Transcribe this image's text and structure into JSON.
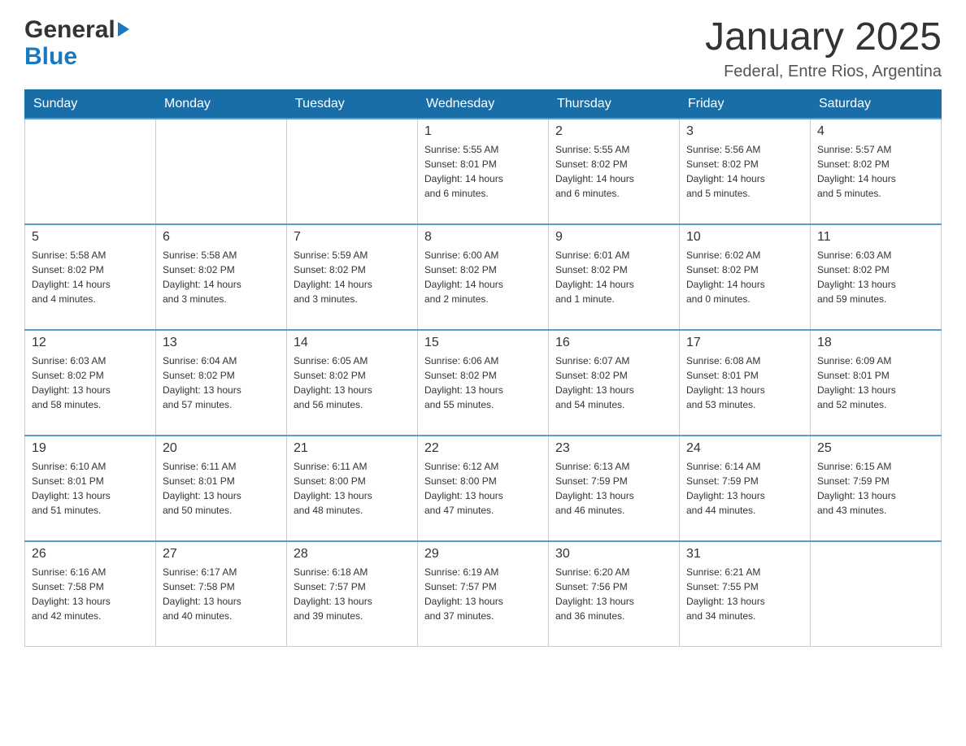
{
  "header": {
    "logo_general": "General",
    "logo_blue": "Blue",
    "title": "January 2025",
    "location": "Federal, Entre Rios, Argentina"
  },
  "days_of_week": [
    "Sunday",
    "Monday",
    "Tuesday",
    "Wednesday",
    "Thursday",
    "Friday",
    "Saturday"
  ],
  "weeks": [
    {
      "days": [
        {
          "number": "",
          "info": ""
        },
        {
          "number": "",
          "info": ""
        },
        {
          "number": "",
          "info": ""
        },
        {
          "number": "1",
          "info": "Sunrise: 5:55 AM\nSunset: 8:01 PM\nDaylight: 14 hours\nand 6 minutes."
        },
        {
          "number": "2",
          "info": "Sunrise: 5:55 AM\nSunset: 8:02 PM\nDaylight: 14 hours\nand 6 minutes."
        },
        {
          "number": "3",
          "info": "Sunrise: 5:56 AM\nSunset: 8:02 PM\nDaylight: 14 hours\nand 5 minutes."
        },
        {
          "number": "4",
          "info": "Sunrise: 5:57 AM\nSunset: 8:02 PM\nDaylight: 14 hours\nand 5 minutes."
        }
      ]
    },
    {
      "days": [
        {
          "number": "5",
          "info": "Sunrise: 5:58 AM\nSunset: 8:02 PM\nDaylight: 14 hours\nand 4 minutes."
        },
        {
          "number": "6",
          "info": "Sunrise: 5:58 AM\nSunset: 8:02 PM\nDaylight: 14 hours\nand 3 minutes."
        },
        {
          "number": "7",
          "info": "Sunrise: 5:59 AM\nSunset: 8:02 PM\nDaylight: 14 hours\nand 3 minutes."
        },
        {
          "number": "8",
          "info": "Sunrise: 6:00 AM\nSunset: 8:02 PM\nDaylight: 14 hours\nand 2 minutes."
        },
        {
          "number": "9",
          "info": "Sunrise: 6:01 AM\nSunset: 8:02 PM\nDaylight: 14 hours\nand 1 minute."
        },
        {
          "number": "10",
          "info": "Sunrise: 6:02 AM\nSunset: 8:02 PM\nDaylight: 14 hours\nand 0 minutes."
        },
        {
          "number": "11",
          "info": "Sunrise: 6:03 AM\nSunset: 8:02 PM\nDaylight: 13 hours\nand 59 minutes."
        }
      ]
    },
    {
      "days": [
        {
          "number": "12",
          "info": "Sunrise: 6:03 AM\nSunset: 8:02 PM\nDaylight: 13 hours\nand 58 minutes."
        },
        {
          "number": "13",
          "info": "Sunrise: 6:04 AM\nSunset: 8:02 PM\nDaylight: 13 hours\nand 57 minutes."
        },
        {
          "number": "14",
          "info": "Sunrise: 6:05 AM\nSunset: 8:02 PM\nDaylight: 13 hours\nand 56 minutes."
        },
        {
          "number": "15",
          "info": "Sunrise: 6:06 AM\nSunset: 8:02 PM\nDaylight: 13 hours\nand 55 minutes."
        },
        {
          "number": "16",
          "info": "Sunrise: 6:07 AM\nSunset: 8:02 PM\nDaylight: 13 hours\nand 54 minutes."
        },
        {
          "number": "17",
          "info": "Sunrise: 6:08 AM\nSunset: 8:01 PM\nDaylight: 13 hours\nand 53 minutes."
        },
        {
          "number": "18",
          "info": "Sunrise: 6:09 AM\nSunset: 8:01 PM\nDaylight: 13 hours\nand 52 minutes."
        }
      ]
    },
    {
      "days": [
        {
          "number": "19",
          "info": "Sunrise: 6:10 AM\nSunset: 8:01 PM\nDaylight: 13 hours\nand 51 minutes."
        },
        {
          "number": "20",
          "info": "Sunrise: 6:11 AM\nSunset: 8:01 PM\nDaylight: 13 hours\nand 50 minutes."
        },
        {
          "number": "21",
          "info": "Sunrise: 6:11 AM\nSunset: 8:00 PM\nDaylight: 13 hours\nand 48 minutes."
        },
        {
          "number": "22",
          "info": "Sunrise: 6:12 AM\nSunset: 8:00 PM\nDaylight: 13 hours\nand 47 minutes."
        },
        {
          "number": "23",
          "info": "Sunrise: 6:13 AM\nSunset: 7:59 PM\nDaylight: 13 hours\nand 46 minutes."
        },
        {
          "number": "24",
          "info": "Sunrise: 6:14 AM\nSunset: 7:59 PM\nDaylight: 13 hours\nand 44 minutes."
        },
        {
          "number": "25",
          "info": "Sunrise: 6:15 AM\nSunset: 7:59 PM\nDaylight: 13 hours\nand 43 minutes."
        }
      ]
    },
    {
      "days": [
        {
          "number": "26",
          "info": "Sunrise: 6:16 AM\nSunset: 7:58 PM\nDaylight: 13 hours\nand 42 minutes."
        },
        {
          "number": "27",
          "info": "Sunrise: 6:17 AM\nSunset: 7:58 PM\nDaylight: 13 hours\nand 40 minutes."
        },
        {
          "number": "28",
          "info": "Sunrise: 6:18 AM\nSunset: 7:57 PM\nDaylight: 13 hours\nand 39 minutes."
        },
        {
          "number": "29",
          "info": "Sunrise: 6:19 AM\nSunset: 7:57 PM\nDaylight: 13 hours\nand 37 minutes."
        },
        {
          "number": "30",
          "info": "Sunrise: 6:20 AM\nSunset: 7:56 PM\nDaylight: 13 hours\nand 36 minutes."
        },
        {
          "number": "31",
          "info": "Sunrise: 6:21 AM\nSunset: 7:55 PM\nDaylight: 13 hours\nand 34 minutes."
        },
        {
          "number": "",
          "info": ""
        }
      ]
    }
  ]
}
